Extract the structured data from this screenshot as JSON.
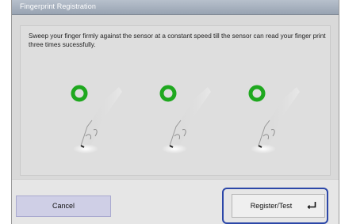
{
  "dialog": {
    "title": "Fingerprint Registration",
    "instruction": "Sweep your finger firmly against the sensor at a constant speed till the sensor can read your finger print three times sucessfully."
  },
  "steps": [
    {
      "status": "success",
      "ring_color": "#1fa81f"
    },
    {
      "status": "success",
      "ring_color": "#1fa81f"
    },
    {
      "status": "success",
      "ring_color": "#1fa81f"
    }
  ],
  "buttons": {
    "cancel_label": "Cancel",
    "register_label": "Register/Test"
  },
  "colors": {
    "title_bar": "#a7b0bd",
    "highlight_border": "#2c47a8",
    "cancel_bg": "#cfcfe6"
  }
}
